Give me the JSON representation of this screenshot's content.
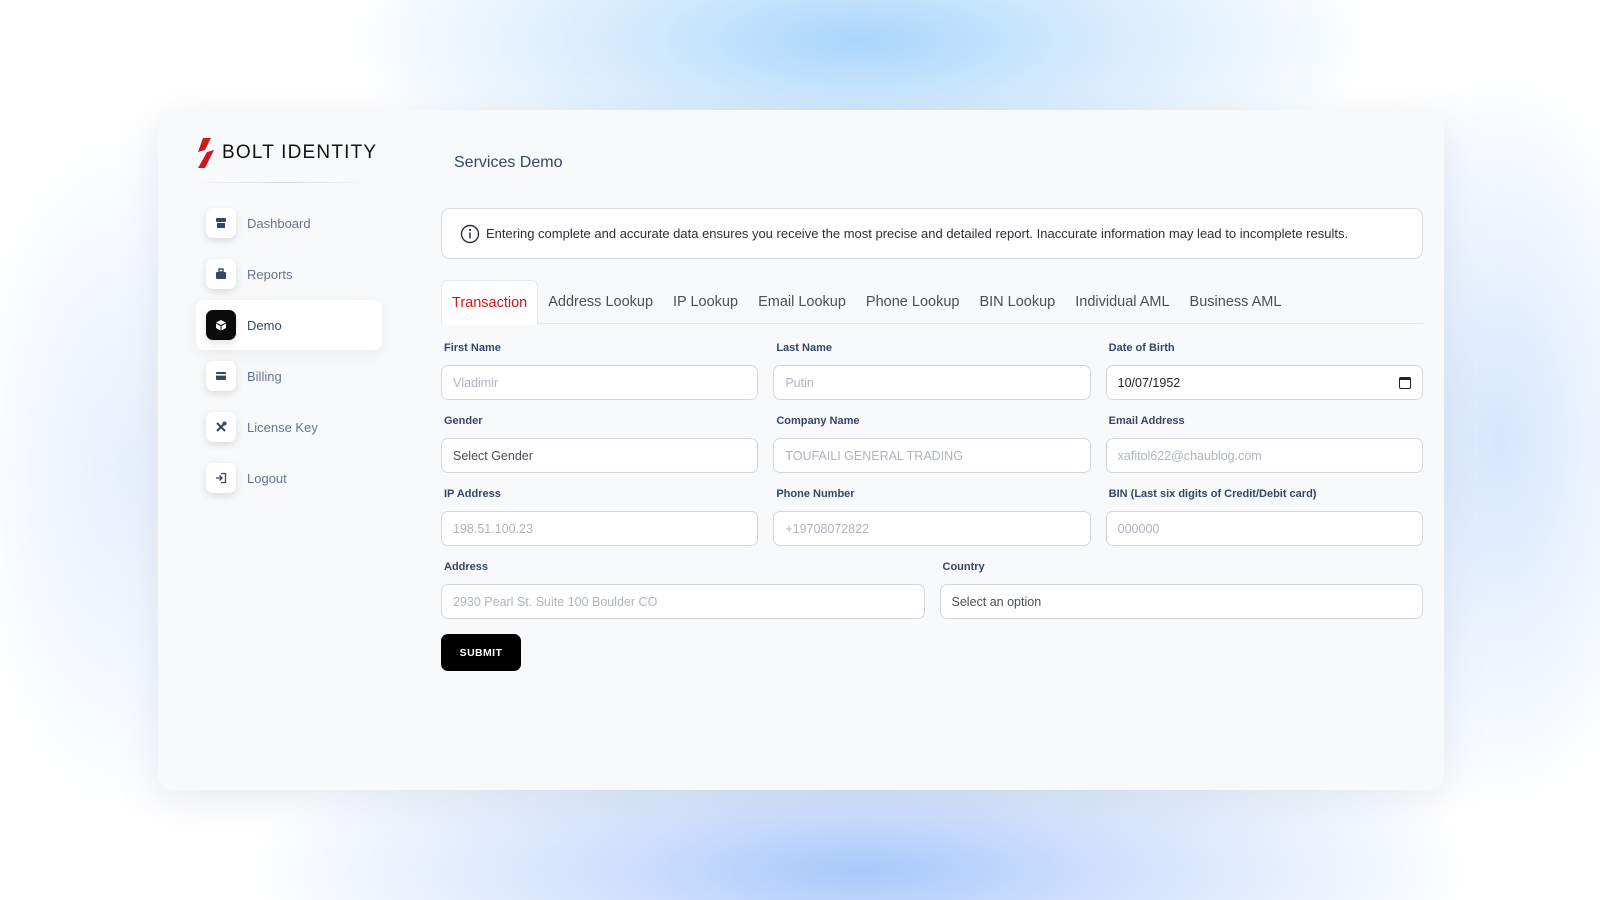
{
  "brand": {
    "name": "BOLT IDENTITY",
    "accent": "#d0171b"
  },
  "sidebar": {
    "items": [
      {
        "label": "Dashboard",
        "icon": "store-icon",
        "active": false
      },
      {
        "label": "Reports",
        "icon": "briefcase-icon",
        "active": false
      },
      {
        "label": "Demo",
        "icon": "box-icon",
        "active": true
      },
      {
        "label": "Billing",
        "icon": "credit-card-icon",
        "active": false
      },
      {
        "label": "License Key",
        "icon": "tools-icon",
        "active": false
      },
      {
        "label": "Logout",
        "icon": "logout-icon",
        "active": false
      }
    ]
  },
  "main": {
    "title": "Services Demo",
    "alert": {
      "icon": "info-icon",
      "text": "Entering complete and accurate data ensures you receive the most precise and detailed report. Inaccurate information may lead to incomplete results."
    },
    "tabs": [
      {
        "label": "Transaction",
        "active": true
      },
      {
        "label": "Address Lookup",
        "active": false
      },
      {
        "label": "IP Lookup",
        "active": false
      },
      {
        "label": "Email Lookup",
        "active": false
      },
      {
        "label": "Phone Lookup",
        "active": false
      },
      {
        "label": "BIN Lookup",
        "active": false
      },
      {
        "label": "Individual AML",
        "active": false
      },
      {
        "label": "Business AML",
        "active": false
      }
    ],
    "form": {
      "first_name": {
        "label": "First Name",
        "placeholder": "Vladimir"
      },
      "last_name": {
        "label": "Last Name",
        "placeholder": "Putin"
      },
      "dob": {
        "label": "Date of Birth",
        "value": "10/07/1952"
      },
      "gender": {
        "label": "Gender",
        "value": "Select Gender"
      },
      "company": {
        "label": "Company Name",
        "placeholder": "TOUFAILI GENERAL TRADING"
      },
      "email": {
        "label": "Email Address",
        "placeholder": "xafitol622@chaublog.com"
      },
      "ip": {
        "label": "IP Address",
        "placeholder": "198.51.100.23"
      },
      "phone": {
        "label": "Phone Number",
        "placeholder": "+19708072822"
      },
      "bin": {
        "label": "BIN (Last six digits of Credit/Debit card)",
        "placeholder": "000000"
      },
      "address": {
        "label": "Address",
        "placeholder": "2930 Pearl St. Suite 100 Boulder CO"
      },
      "country": {
        "label": "Country",
        "value": "Select an option"
      },
      "submit_label": "SUBMIT"
    }
  }
}
